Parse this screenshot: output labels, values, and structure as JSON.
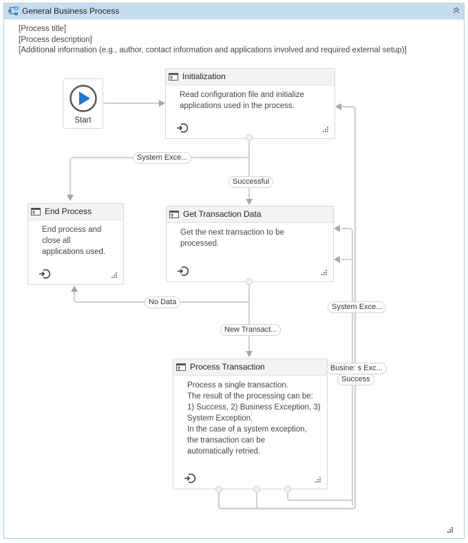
{
  "window": {
    "title": "General Business Process",
    "icon": "flowchart-icon",
    "collapse_icon": "double-chevron-up-icon"
  },
  "annotation": {
    "lines": [
      "[Process title]",
      "[Process description]",
      "[Additional information (e.g., author, contact information and applications involved and required external setup)]"
    ]
  },
  "start": {
    "label": "Start",
    "icon": "play-icon",
    "accent": "#1e78d7"
  },
  "states": {
    "initialization": {
      "title": "Initialization",
      "description": [
        "Read configuration file and initialize",
        "applications used in the process."
      ]
    },
    "end_process": {
      "title": "End Process",
      "description": [
        "End process and",
        "close all",
        "applications used."
      ]
    },
    "get_transaction": {
      "title": "Get Transaction Data",
      "description": [
        "Get the next transaction to be",
        "processed."
      ]
    },
    "process_transaction": {
      "title": "Process Transaction",
      "description": [
        "Process a single transaction.",
        "The result of the processing can be:",
        "1) Success, 2) Business Exception, 3)",
        "System Exception.",
        "In the case of a system exception,",
        "the transaction can be",
        "automatically retried."
      ]
    }
  },
  "transitions": {
    "init_system_exception": "System Exce...",
    "init_successful": "Successful",
    "get_no_data": "No Data",
    "get_new_transaction": "New Transact...",
    "process_system_exception": "System Exce...",
    "process_business_exception": "Busine: s Exc...",
    "process_success": "Success"
  },
  "colors": {
    "title_bar": "#c7ddef",
    "frame_border": "#a8cbe0",
    "connector": "#d0d0d0",
    "arrow": "#a6a6a6"
  }
}
